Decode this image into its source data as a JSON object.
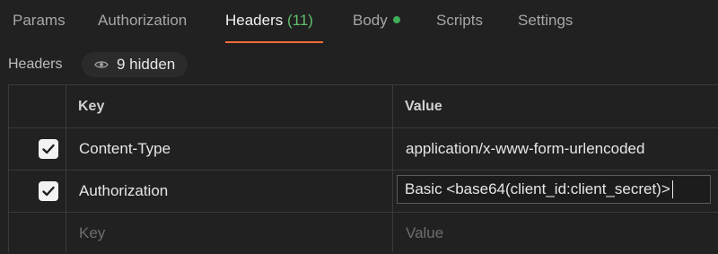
{
  "tabs": [
    {
      "label": "Params"
    },
    {
      "label": "Authorization"
    },
    {
      "label": "Headers",
      "count": "(11)",
      "active": true
    },
    {
      "label": "Body",
      "has_dot": true
    },
    {
      "label": "Scripts"
    },
    {
      "label": "Settings"
    }
  ],
  "section": {
    "title": "Headers",
    "hidden_text": "9 hidden"
  },
  "table": {
    "columns": [
      "Key",
      "Value"
    ],
    "rows": [
      {
        "checked": true,
        "key": "Content-Type",
        "value": "application/x-www-form-urlencoded"
      },
      {
        "checked": true,
        "key": "Authorization",
        "value": "Basic <base64(client_id:client_secret)>"
      }
    ],
    "placeholder": {
      "key": "Key",
      "value": "Value"
    }
  },
  "colors": {
    "accent_underline": "#f26b3a",
    "count_green": "#5fbf6e",
    "dot_green": "#3fae5a"
  }
}
